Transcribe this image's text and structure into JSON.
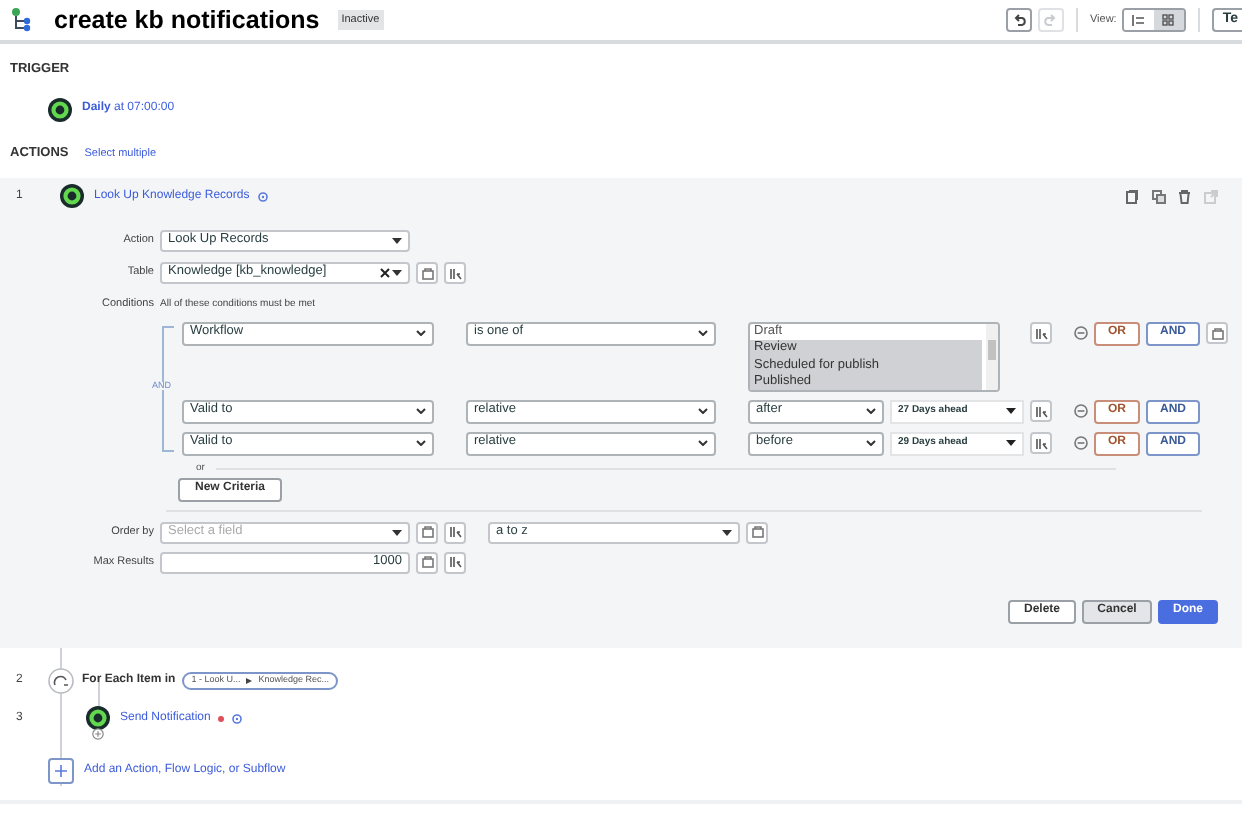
{
  "header": {
    "title": "create kb notifications",
    "status_badge": "Inactive",
    "history_buttons": [
      {
        "kind": "undo",
        "disabled": false
      },
      {
        "kind": "redo",
        "disabled": true
      }
    ],
    "view_label": "View:",
    "view_modes": [
      {
        "kind": "list",
        "selected": false
      },
      {
        "kind": "grid",
        "selected": true
      }
    ],
    "test_button": "Te"
  },
  "trigger": {
    "heading": "TRIGGER",
    "schedule": "Daily",
    "time": "at 07:00:00"
  },
  "actions": {
    "heading": "ACTIONS",
    "select_multiple": "Select multiple"
  },
  "step_1": {
    "number": "1",
    "title": "Look Up Knowledge Records",
    "expanded": true,
    "action": {
      "label": "Action",
      "value": "Look Up Records"
    },
    "table": {
      "label": "Table",
      "value": "Knowledge [kb_knowledge]"
    },
    "conditions": {
      "label": "Conditions",
      "hint": "All of these conditions must be met",
      "connector": "AND",
      "rows": [
        {
          "kind": "list",
          "field": "Workflow",
          "operator": "is one of",
          "options": [
            {
              "label": "Draft",
              "selected": false
            },
            {
              "label": "Review",
              "selected": true
            },
            {
              "label": "Scheduled for publish",
              "selected": true
            },
            {
              "label": "Published",
              "selected": true
            }
          ],
          "or_button": "OR",
          "and_button": "AND"
        },
        {
          "kind": "relative",
          "field": "Valid to",
          "operator": "relative",
          "direction": "after",
          "amount": "27 Days ahead",
          "or_button": "OR",
          "and_button": "AND"
        },
        {
          "kind": "relative",
          "field": "Valid to",
          "operator": "relative",
          "direction": "before",
          "amount": "29 Days ahead",
          "or_button": "OR",
          "and_button": "AND"
        }
      ],
      "or_separator": "or",
      "new_criteria_button": "New Criteria"
    },
    "order_by": {
      "label": "Order by",
      "placeholder": "Select a field",
      "direction": "a to z"
    },
    "max_results": {
      "label": "Max Results",
      "value": "1000"
    },
    "buttons": [
      "Delete",
      "Cancel",
      "Done"
    ]
  },
  "step_2": {
    "number": "2",
    "label": "For Each Item in",
    "pill_source": "1 - Look U...",
    "pill_field": "Knowledge Rec..."
  },
  "step_3": {
    "number": "3",
    "title": "Send Notification",
    "required": true
  },
  "add_link": "Add an Action, Flow Logic, or Subflow"
}
